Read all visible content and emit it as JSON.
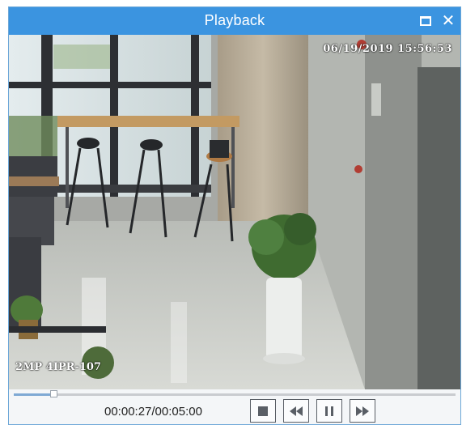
{
  "window": {
    "title": "Playback",
    "maximize_icon": "maximize-icon",
    "close_icon": "close-icon",
    "close_glyph": "✕",
    "accent": "#3b94e0"
  },
  "video": {
    "osd_datetime": "06/19/2019 15:56:53",
    "osd_camera": "2MP 4IPR-107"
  },
  "controls": {
    "timecode": "00:00:27/00:05:00",
    "progress": 0.09,
    "buttons": [
      "stop-icon",
      "slow-down-icon",
      "pause-icon",
      "fast-forward-icon"
    ]
  }
}
